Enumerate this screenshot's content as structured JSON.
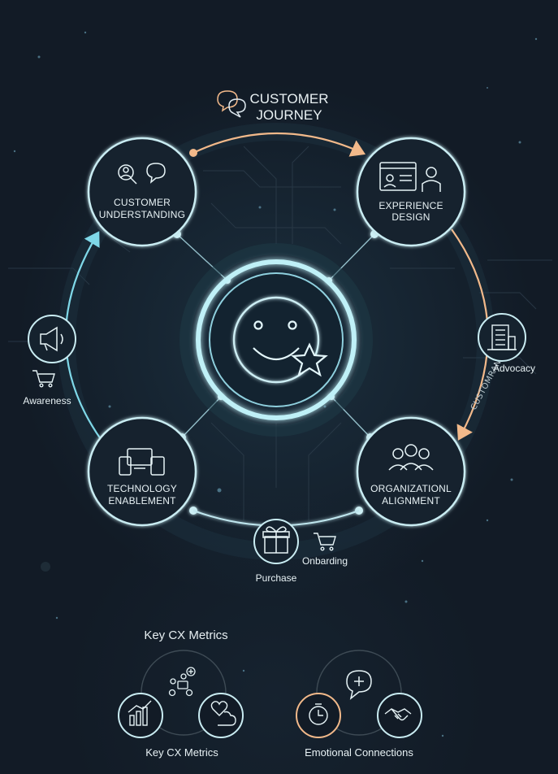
{
  "diagram": {
    "title_line1": "CUSTOMER",
    "title_line2": "JOURNEY",
    "center": {
      "icon": "smiley-star-icon"
    },
    "pillars": [
      {
        "id": "customer-understanding",
        "line1": "CUSTOMER",
        "line2": "UNDERSTANDING",
        "icon": "magnifier-chat-icon"
      },
      {
        "id": "experience-design",
        "line1": "EXPERIENCE",
        "line2": "DESIGN",
        "icon": "profile-card-person-icon"
      },
      {
        "id": "technology-enablement",
        "line1": "TECHNOLOGY",
        "line2": "ENABLEMENT",
        "icon": "devices-icon"
      },
      {
        "id": "organizational-alignment",
        "line1": "ORGANIZATIONL",
        "line2": "ALIGNMENT",
        "icon": "team-icon"
      }
    ],
    "stages": {
      "awareness": "Awareness",
      "purchase": "Purchase",
      "onboarding": "Onbarding",
      "advocacy": "Advocacy"
    },
    "arc_text": "CUSTOMRANCY",
    "colors": {
      "accent_orange": "#f2b98a",
      "accent_cyan": "#7fd8e8",
      "ring": "#bfe6ee"
    }
  },
  "metrics": {
    "section_title": "Key CX Metrics",
    "left_label": "Key CX Metrics",
    "right_label": "Emotional Connections",
    "icons": [
      "team-lock-icon",
      "bar-chart-icon",
      "heart-cloud-icon",
      "chat-plus-icon",
      "clock-icon",
      "handshake-icon"
    ]
  }
}
